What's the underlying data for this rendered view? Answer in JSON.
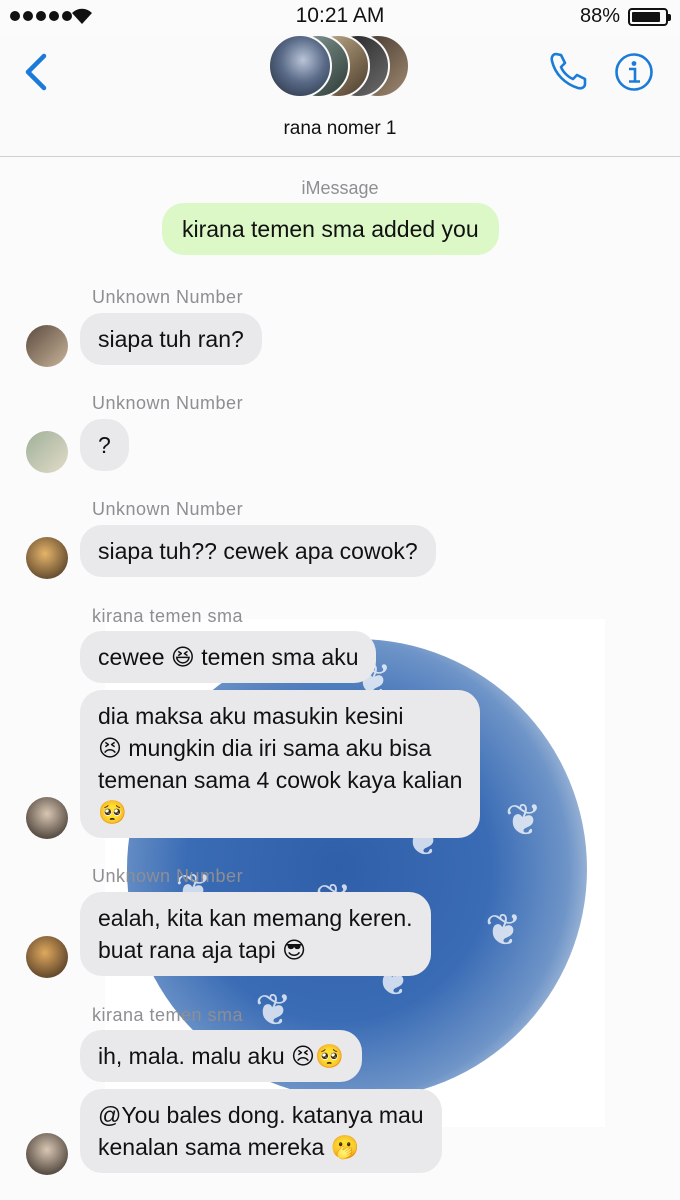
{
  "status_bar": {
    "time": "10:21 AM",
    "battery_percent": "88%",
    "battery_level": 0.88
  },
  "header": {
    "group_name": "rana nomer 1"
  },
  "conversation": {
    "service_label": "iMessage",
    "system_message": "kirana temen sma added you",
    "messages": [
      {
        "sender": "Unknown Number",
        "lines": [
          "siapa tuh ran?"
        ]
      },
      {
        "sender": "Unknown Number",
        "lines": [
          "?"
        ]
      },
      {
        "sender": "Unknown Number",
        "lines": [
          "siapa tuh?? cewek apa cowok?"
        ]
      },
      {
        "sender": "kirana temen sma",
        "lines": [
          "cewee 😆 temen sma aku"
        ]
      },
      {
        "sender": "",
        "lines": [
          "dia maksa aku masukin kesini",
          "😣 mungkin dia iri sama aku bisa",
          "temenan sama 4 cowok kaya kalian",
          "🥺"
        ]
      },
      {
        "sender": "Unknown Number",
        "lines": [
          "ealah, kita kan memang keren.",
          "buat rana aja tapi 😎"
        ]
      },
      {
        "sender": "kirana temen sma",
        "lines": [
          "ih, mala. malu aku 😣🥺"
        ]
      },
      {
        "sender": "",
        "lines": [
          "@You bales dong. katanya mau",
          "kenalan sama mereka 🫢"
        ]
      }
    ]
  },
  "colors": {
    "accent": "#1a7cd8",
    "incoming_bubble": "#e9e9eb",
    "system_bubble": "#dcf8c6"
  }
}
